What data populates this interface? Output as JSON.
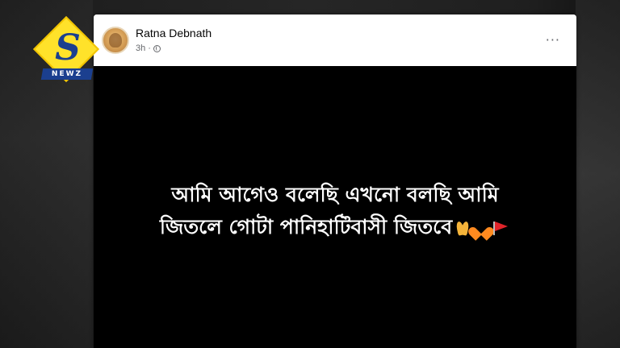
{
  "post": {
    "author": "Ratna Debnath",
    "time": "3h ·",
    "more_label": "···",
    "text_line1": "আমি আগেও বলেছি এখনো বলছি আমি",
    "text_line2": "জিতলে গোটা পানিহাটিবাসী জিতবে",
    "emojis": [
      "folded-hands",
      "orange-heart",
      "red-flag"
    ]
  },
  "logo": {
    "letter": "S",
    "banner": "NEWZ"
  },
  "colors": {
    "post_background": "#000000",
    "post_text": "#ffffff",
    "logo_yellow": "#ffe22a",
    "logo_blue": "#1b3f8f",
    "meta_gray": "#65676b"
  }
}
